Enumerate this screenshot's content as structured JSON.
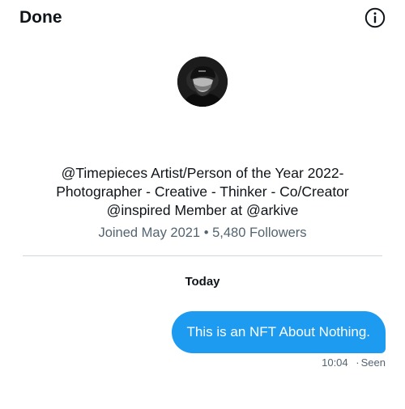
{
  "header": {
    "done_label": "Done",
    "info_icon": "info-circle-icon"
  },
  "profile": {
    "avatar_icon": "profile-photo",
    "bio_lines": [
      "@Timepieces Artist/Person of the Year 2022-",
      "Photographer - Creative - Thinker - Co/Creator",
      "@inspired Member at @arkive"
    ],
    "joined": "Joined May 2021",
    "separator": "•",
    "followers": "5,480 Followers"
  },
  "conversation": {
    "day_label": "Today",
    "messages": [
      {
        "text": "This is an NFT About Nothing.",
        "time": "10:04",
        "status": "Seen",
        "status_separator": "·"
      }
    ]
  },
  "colors": {
    "accent": "#1d9bf0",
    "text_primary": "#0f1419",
    "text_secondary": "#536471",
    "divider": "#cfd9de"
  }
}
